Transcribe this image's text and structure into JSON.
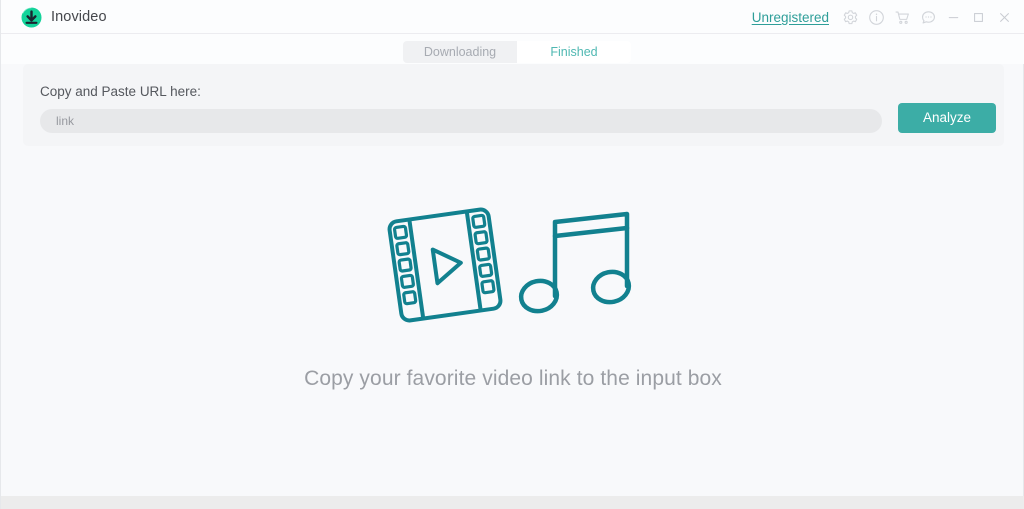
{
  "window": {
    "app_title": "Inovideo",
    "logo_icon": "download-circle-icon",
    "accent_color": "#3cada6",
    "background_color": "#f8f9fb"
  },
  "titlebar": {
    "unregistered_label": "Unregistered",
    "icons": [
      {
        "name": "settings-icon",
        "glyph": "gear"
      },
      {
        "name": "info-icon",
        "glyph": "info-circle"
      },
      {
        "name": "cart-icon",
        "glyph": "shopping-cart"
      },
      {
        "name": "feedback-icon",
        "glyph": "speech-bubble"
      }
    ],
    "window_controls": [
      {
        "name": "minimize-button",
        "glyph": "minimize"
      },
      {
        "name": "maximize-button",
        "glyph": "maximize"
      },
      {
        "name": "close-button",
        "glyph": "close"
      }
    ]
  },
  "tabs": [
    {
      "label": "Downloading",
      "active": false
    },
    {
      "label": "Finished",
      "active": true
    }
  ],
  "url_panel": {
    "label": "Copy and Paste URL here:",
    "input_value": "",
    "input_placeholder": "link",
    "analyze_label": "Analyze"
  },
  "empty_state": {
    "illustration": "film-strip-and-music-note",
    "message": "Copy your favorite video link to the input box"
  }
}
